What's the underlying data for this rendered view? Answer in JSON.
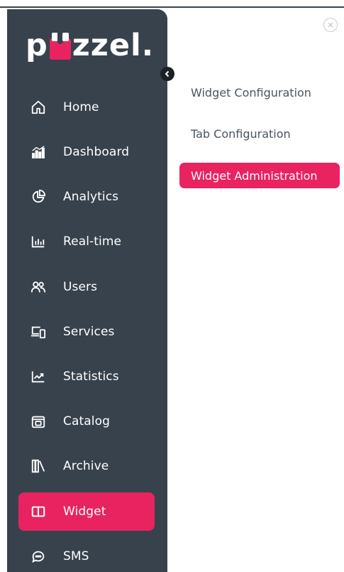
{
  "colors": {
    "sidebar_bg": "#37424d",
    "accent": "#e8235f",
    "text_muted": "#4a5561"
  },
  "brand": {
    "logo_prefix": "p",
    "logo_suffix": "zzel."
  },
  "sidebar": {
    "items": [
      {
        "label": "Home",
        "icon": "home-icon",
        "active": false
      },
      {
        "label": "Dashboard",
        "icon": "dashboard-icon",
        "active": false
      },
      {
        "label": "Analytics",
        "icon": "pie-chart-icon",
        "active": false
      },
      {
        "label": "Real-time",
        "icon": "bar-chart-icon",
        "active": false
      },
      {
        "label": "Users",
        "icon": "users-icon",
        "active": false
      },
      {
        "label": "Services",
        "icon": "devices-icon",
        "active": false
      },
      {
        "label": "Statistics",
        "icon": "line-chart-icon",
        "active": false
      },
      {
        "label": "Catalog",
        "icon": "catalog-icon",
        "active": false
      },
      {
        "label": "Archive",
        "icon": "archive-icon",
        "active": false
      },
      {
        "label": "Widget",
        "icon": "widget-icon",
        "active": true
      },
      {
        "label": "SMS",
        "icon": "sms-icon",
        "active": false
      }
    ]
  },
  "submenu": {
    "items": [
      {
        "label": "Widget Configuration",
        "active": false
      },
      {
        "label": "Tab Configuration",
        "active": false
      },
      {
        "label": "Widget Administration",
        "active": true
      }
    ]
  }
}
